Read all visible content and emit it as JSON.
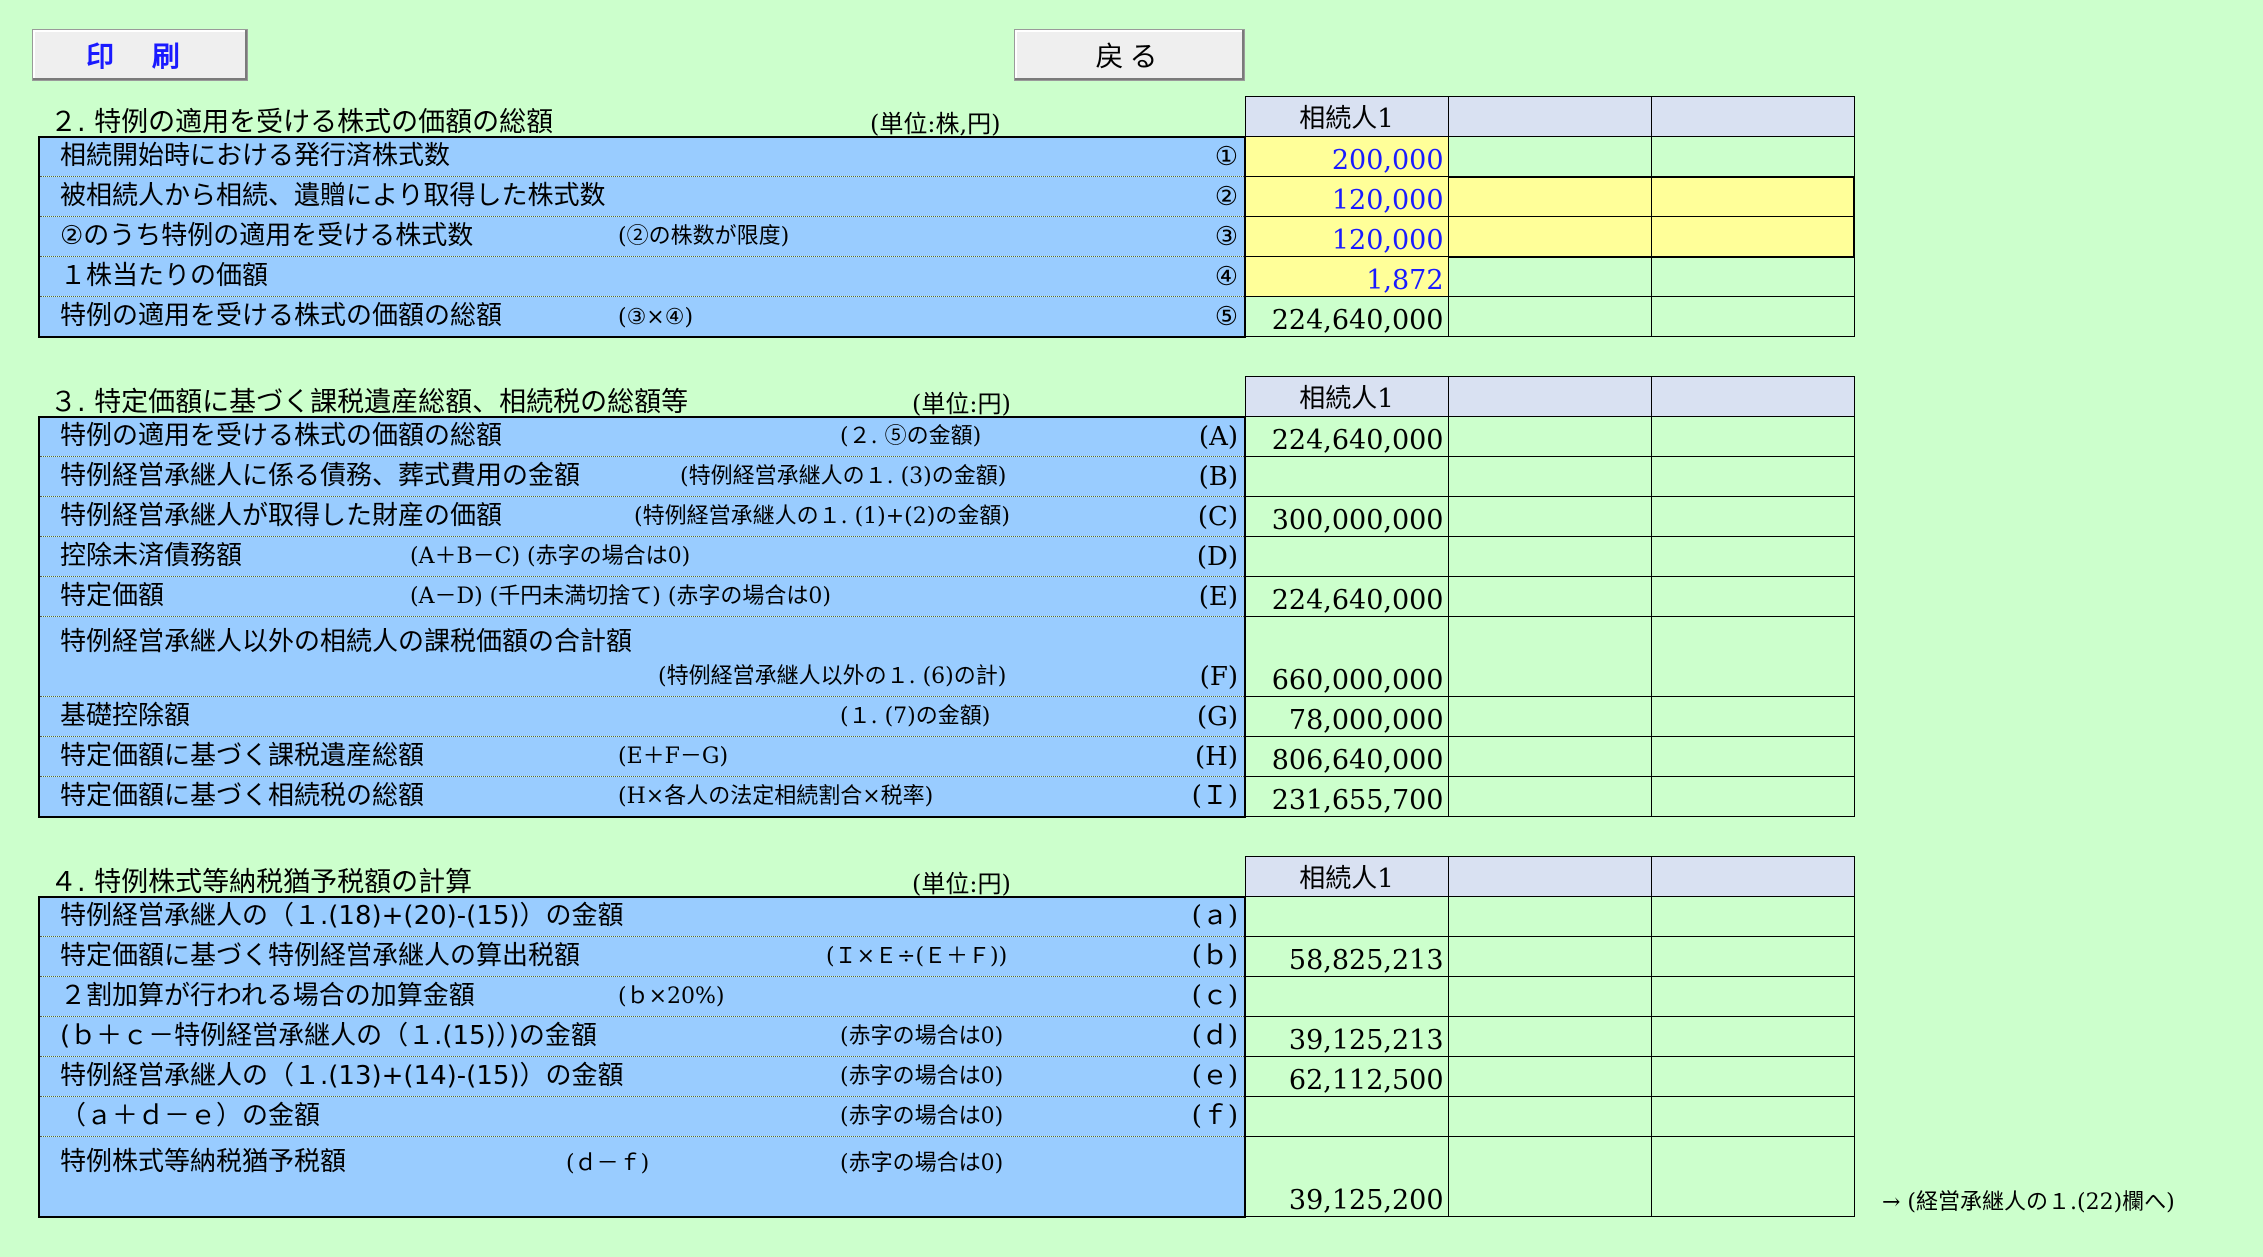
{
  "buttons": {
    "print": "印 刷",
    "back": "戻る"
  },
  "section2": {
    "title": "２. 特例の適用を受ける株式の価額の総額",
    "unit": "(単位:株,円)",
    "header": [
      "相続人1",
      "",
      ""
    ],
    "rows": [
      {
        "label": "相続開始時における発行済株式数",
        "note": "",
        "mark": "①",
        "value": "200,000"
      },
      {
        "label": "被相続人から相続、遺贈により取得した株式数",
        "note": "",
        "mark": "②",
        "value": "120,000"
      },
      {
        "label": "②のうち特例の適用を受ける株式数",
        "note": "(②の株数が限度)",
        "mark": "③",
        "value": "120,000"
      },
      {
        "label": "１株当たりの価額",
        "note": "",
        "mark": "④",
        "value": "1,872"
      },
      {
        "label": "特例の適用を受ける株式の価額の総額",
        "note": "(③×④)",
        "mark": "⑤",
        "value": "224,640,000"
      }
    ]
  },
  "section3": {
    "title": "３. 特定価額に基づく課税遺産総額、相続税の総額等",
    "unit": "(単位:円)",
    "header": [
      "相続人1",
      "",
      ""
    ],
    "rows": [
      {
        "label": "特例の適用を受ける株式の価額の総額",
        "note": "(２. ⑤の金額)",
        "mark": "(A)",
        "value": "224,640,000"
      },
      {
        "label": "特例経営承継人に係る債務、葬式費用の金額",
        "note": "(特例経営承継人の１. (3)の金額)",
        "mark": "(B)",
        "value": ""
      },
      {
        "label": "特例経営承継人が取得した財産の価額",
        "note": "(特例経営承継人の１. (1)+(2)の金額)",
        "mark": "(C)",
        "value": "300,000,000"
      },
      {
        "label": "控除未済債務額",
        "note": "(A＋B－C) (赤字の場合は0)",
        "mark": "(D)",
        "value": ""
      },
      {
        "label": "特定価額",
        "note": "(A－D) (千円未満切捨て) (赤字の場合は0)",
        "mark": "(E)",
        "value": "224,640,000"
      },
      {
        "label": "特例経営承継人以外の相続人の課税価額の合計額",
        "note": "(特例経営承継人以外の１. (6)の計)",
        "mark": "(F)",
        "value": "660,000,000"
      },
      {
        "label": "基礎控除額",
        "note": "(１. (7)の金額)",
        "mark": "(G)",
        "value": "78,000,000"
      },
      {
        "label": "特定価額に基づく課税遺産総額",
        "note": "(E＋F－G)",
        "mark": "(H)",
        "value": "806,640,000"
      },
      {
        "label": "特定価額に基づく相続税の総額",
        "note": "(H×各人の法定相続割合×税率)",
        "mark": "(Ｉ)",
        "value": "231,655,700"
      }
    ]
  },
  "section4": {
    "title": "４. 特例株式等納税猶予税額の計算",
    "unit": "(単位:円)",
    "header": [
      "相続人1",
      "",
      ""
    ],
    "rows": [
      {
        "label": "特例経営承継人の（１.(18)+(20)-(15)）の金額",
        "note": "",
        "mark": "(ａ)",
        "value": ""
      },
      {
        "label": "特定価額に基づく特例経営承継人の算出税額",
        "note": "(Ｉ×Ｅ÷(Ｅ＋Ｆ))",
        "mark": "(ｂ)",
        "value": "58,825,213"
      },
      {
        "label": "２割加算が行われる場合の加算金額",
        "note": "(ｂ×20%)",
        "mark": "(ｃ)",
        "value": ""
      },
      {
        "label": "(ｂ＋ｃ－特例経営承継人の（１.(15)）)の金額",
        "note": "(赤字の場合は0)",
        "mark": "(ｄ)",
        "value": "39,125,213"
      },
      {
        "label": "特例経営承継人の（１.(13)+(14)-(15)）の金額",
        "note": "(赤字の場合は0)",
        "mark": "(ｅ)",
        "value": "62,112,500"
      },
      {
        "label": "（ａ＋ｄ－ｅ）の金額",
        "note": "(赤字の場合は0)",
        "mark": "(ｆ)",
        "value": ""
      },
      {
        "label": "特例株式等納税猶予税額",
        "note": "(赤字の場合は0)",
        "note2": "(ｄ－ｆ)",
        "mark": "",
        "value": "39,125,200"
      }
    ],
    "arrow_note": "→ (経営承継人の１.(22)欄へ)"
  }
}
